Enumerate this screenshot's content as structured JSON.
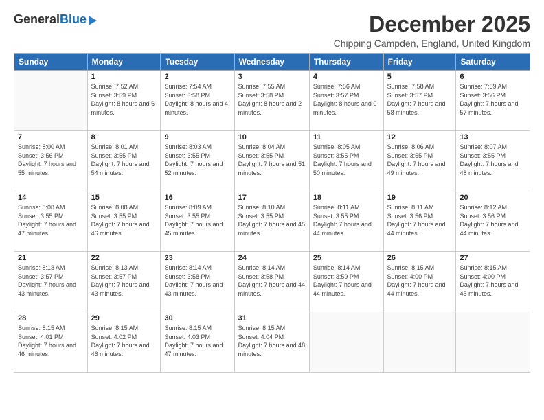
{
  "header": {
    "logo_general": "General",
    "logo_blue": "Blue",
    "month_title": "December 2025",
    "location": "Chipping Campden, England, United Kingdom"
  },
  "days_of_week": [
    "Sunday",
    "Monday",
    "Tuesday",
    "Wednesday",
    "Thursday",
    "Friday",
    "Saturday"
  ],
  "weeks": [
    [
      {
        "day": "",
        "info": ""
      },
      {
        "day": "1",
        "info": "Sunrise: 7:52 AM\nSunset: 3:59 PM\nDaylight: 8 hours\nand 6 minutes."
      },
      {
        "day": "2",
        "info": "Sunrise: 7:54 AM\nSunset: 3:58 PM\nDaylight: 8 hours\nand 4 minutes."
      },
      {
        "day": "3",
        "info": "Sunrise: 7:55 AM\nSunset: 3:58 PM\nDaylight: 8 hours\nand 2 minutes."
      },
      {
        "day": "4",
        "info": "Sunrise: 7:56 AM\nSunset: 3:57 PM\nDaylight: 8 hours\nand 0 minutes."
      },
      {
        "day": "5",
        "info": "Sunrise: 7:58 AM\nSunset: 3:57 PM\nDaylight: 7 hours\nand 58 minutes."
      },
      {
        "day": "6",
        "info": "Sunrise: 7:59 AM\nSunset: 3:56 PM\nDaylight: 7 hours\nand 57 minutes."
      }
    ],
    [
      {
        "day": "7",
        "info": "Sunrise: 8:00 AM\nSunset: 3:56 PM\nDaylight: 7 hours\nand 55 minutes."
      },
      {
        "day": "8",
        "info": "Sunrise: 8:01 AM\nSunset: 3:55 PM\nDaylight: 7 hours\nand 54 minutes."
      },
      {
        "day": "9",
        "info": "Sunrise: 8:03 AM\nSunset: 3:55 PM\nDaylight: 7 hours\nand 52 minutes."
      },
      {
        "day": "10",
        "info": "Sunrise: 8:04 AM\nSunset: 3:55 PM\nDaylight: 7 hours\nand 51 minutes."
      },
      {
        "day": "11",
        "info": "Sunrise: 8:05 AM\nSunset: 3:55 PM\nDaylight: 7 hours\nand 50 minutes."
      },
      {
        "day": "12",
        "info": "Sunrise: 8:06 AM\nSunset: 3:55 PM\nDaylight: 7 hours\nand 49 minutes."
      },
      {
        "day": "13",
        "info": "Sunrise: 8:07 AM\nSunset: 3:55 PM\nDaylight: 7 hours\nand 48 minutes."
      }
    ],
    [
      {
        "day": "14",
        "info": "Sunrise: 8:08 AM\nSunset: 3:55 PM\nDaylight: 7 hours\nand 47 minutes."
      },
      {
        "day": "15",
        "info": "Sunrise: 8:08 AM\nSunset: 3:55 PM\nDaylight: 7 hours\nand 46 minutes."
      },
      {
        "day": "16",
        "info": "Sunrise: 8:09 AM\nSunset: 3:55 PM\nDaylight: 7 hours\nand 45 minutes."
      },
      {
        "day": "17",
        "info": "Sunrise: 8:10 AM\nSunset: 3:55 PM\nDaylight: 7 hours\nand 45 minutes."
      },
      {
        "day": "18",
        "info": "Sunrise: 8:11 AM\nSunset: 3:55 PM\nDaylight: 7 hours\nand 44 minutes."
      },
      {
        "day": "19",
        "info": "Sunrise: 8:11 AM\nSunset: 3:56 PM\nDaylight: 7 hours\nand 44 minutes."
      },
      {
        "day": "20",
        "info": "Sunrise: 8:12 AM\nSunset: 3:56 PM\nDaylight: 7 hours\nand 44 minutes."
      }
    ],
    [
      {
        "day": "21",
        "info": "Sunrise: 8:13 AM\nSunset: 3:57 PM\nDaylight: 7 hours\nand 43 minutes."
      },
      {
        "day": "22",
        "info": "Sunrise: 8:13 AM\nSunset: 3:57 PM\nDaylight: 7 hours\nand 43 minutes."
      },
      {
        "day": "23",
        "info": "Sunrise: 8:14 AM\nSunset: 3:58 PM\nDaylight: 7 hours\nand 43 minutes."
      },
      {
        "day": "24",
        "info": "Sunrise: 8:14 AM\nSunset: 3:58 PM\nDaylight: 7 hours\nand 44 minutes."
      },
      {
        "day": "25",
        "info": "Sunrise: 8:14 AM\nSunset: 3:59 PM\nDaylight: 7 hours\nand 44 minutes."
      },
      {
        "day": "26",
        "info": "Sunrise: 8:15 AM\nSunset: 4:00 PM\nDaylight: 7 hours\nand 44 minutes."
      },
      {
        "day": "27",
        "info": "Sunrise: 8:15 AM\nSunset: 4:00 PM\nDaylight: 7 hours\nand 45 minutes."
      }
    ],
    [
      {
        "day": "28",
        "info": "Sunrise: 8:15 AM\nSunset: 4:01 PM\nDaylight: 7 hours\nand 46 minutes."
      },
      {
        "day": "29",
        "info": "Sunrise: 8:15 AM\nSunset: 4:02 PM\nDaylight: 7 hours\nand 46 minutes."
      },
      {
        "day": "30",
        "info": "Sunrise: 8:15 AM\nSunset: 4:03 PM\nDaylight: 7 hours\nand 47 minutes."
      },
      {
        "day": "31",
        "info": "Sunrise: 8:15 AM\nSunset: 4:04 PM\nDaylight: 7 hours\nand 48 minutes."
      },
      {
        "day": "",
        "info": ""
      },
      {
        "day": "",
        "info": ""
      },
      {
        "day": "",
        "info": ""
      }
    ]
  ]
}
